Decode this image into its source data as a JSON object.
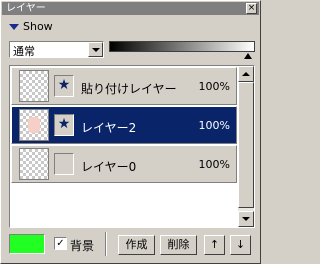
{
  "window": {
    "title": "レイヤー",
    "close_glyph": "×"
  },
  "show": {
    "label": "Show"
  },
  "blend_mode": {
    "selected": "通常"
  },
  "opacity_slider": {
    "value_fraction": 1.0
  },
  "layers": [
    {
      "name": "貼り付けレイヤー",
      "opacity": "100%",
      "checked_glyph": "★",
      "selected": false
    },
    {
      "name": "レイヤー2",
      "opacity": "100%",
      "checked_glyph": "★",
      "selected": true
    },
    {
      "name": "レイヤー0",
      "opacity": "100%",
      "checked_glyph": "",
      "selected": false
    }
  ],
  "footer": {
    "foreground_color": "#22ff22",
    "background_checkbox": {
      "label": "背景",
      "checked": true,
      "glyph": "☑"
    },
    "create_button": "作成",
    "delete_button": "削除",
    "move_up_button": "↑",
    "move_down_button": "↓"
  },
  "colors": {
    "selection": "#0a246a",
    "titlebar": "#7f7f7f",
    "face": "#d4d0c8"
  }
}
